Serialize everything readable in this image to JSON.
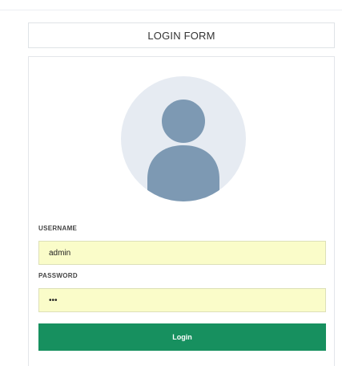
{
  "form": {
    "title": "LOGIN FORM",
    "username_label": "USERNAME",
    "username_value": "admin",
    "password_label": "PASSWORD",
    "password_value": "•••",
    "submit_label": "Login"
  },
  "colors": {
    "button": "#17905f",
    "field_background": "#fafcc9",
    "avatar_background": "#e6ebf2",
    "avatar_figure": "#7d99b3"
  },
  "icons": {
    "avatar": "user-silhouette-icon"
  }
}
